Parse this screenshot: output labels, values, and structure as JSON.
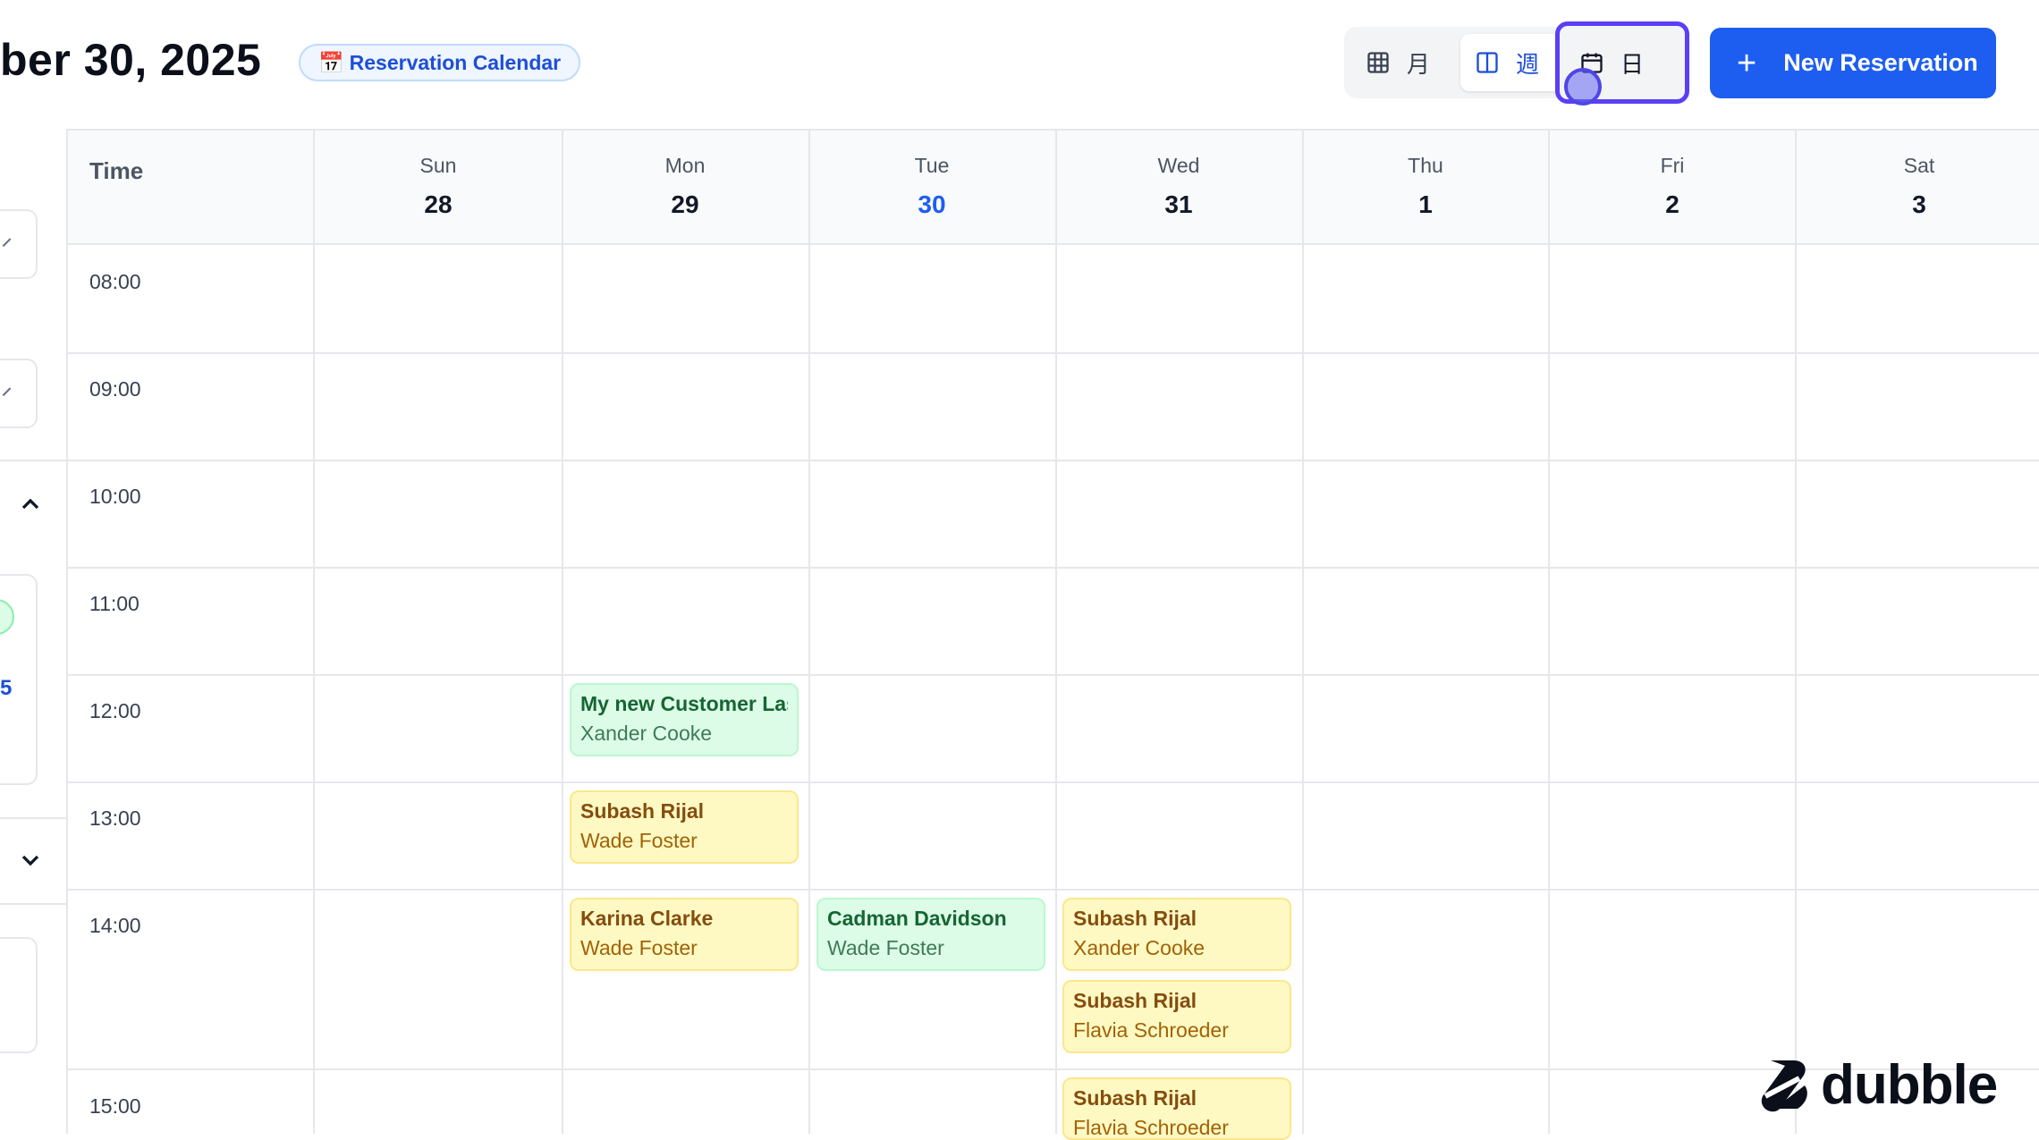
{
  "header": {
    "title": "ber 30, 2025",
    "badge_icon": "📅",
    "badge_label": "Reservation Calendar",
    "views": [
      {
        "icon": "grid-icon",
        "label": "月"
      },
      {
        "icon": "columns-icon",
        "label": "週"
      },
      {
        "icon": "calendar-icon",
        "label": "日"
      }
    ],
    "new_button_label": "New Reservation"
  },
  "sidebar": {
    "partial_number": "5"
  },
  "calendar": {
    "time_header": "Time",
    "days": [
      {
        "name": "Sun",
        "num": "28"
      },
      {
        "name": "Mon",
        "num": "29"
      },
      {
        "name": "Tue",
        "num": "30"
      },
      {
        "name": "Wed",
        "num": "31"
      },
      {
        "name": "Thu",
        "num": "1"
      },
      {
        "name": "Fri",
        "num": "2"
      },
      {
        "name": "Sat",
        "num": "3"
      }
    ],
    "times": [
      "08:00",
      "09:00",
      "10:00",
      "11:00",
      "12:00",
      "13:00",
      "14:00",
      "15:00"
    ],
    "events": [
      {
        "title": "My new Customer Last",
        "staff": "Xander Cooke",
        "color": "green"
      },
      {
        "title": "Subash Rijal",
        "staff": "Wade Foster",
        "color": "yellow"
      },
      {
        "title": "Karina Clarke",
        "staff": "Wade Foster",
        "color": "yellow"
      },
      {
        "title": "Cadman Davidson",
        "staff": "Wade Foster",
        "color": "green"
      },
      {
        "title": "Subash Rijal",
        "staff": "Xander Cooke",
        "color": "yellow"
      },
      {
        "title": "Subash Rijal",
        "staff": "Flavia Schroeder",
        "color": "yellow"
      },
      {
        "title": "Subash Rijal",
        "staff": "Flavia Schroeder",
        "color": "yellow"
      }
    ]
  },
  "brand": {
    "logo_text": "dubble"
  },
  "colors": {
    "accent": "#1d5ef0",
    "selected_outline": "#5b3ff5"
  }
}
